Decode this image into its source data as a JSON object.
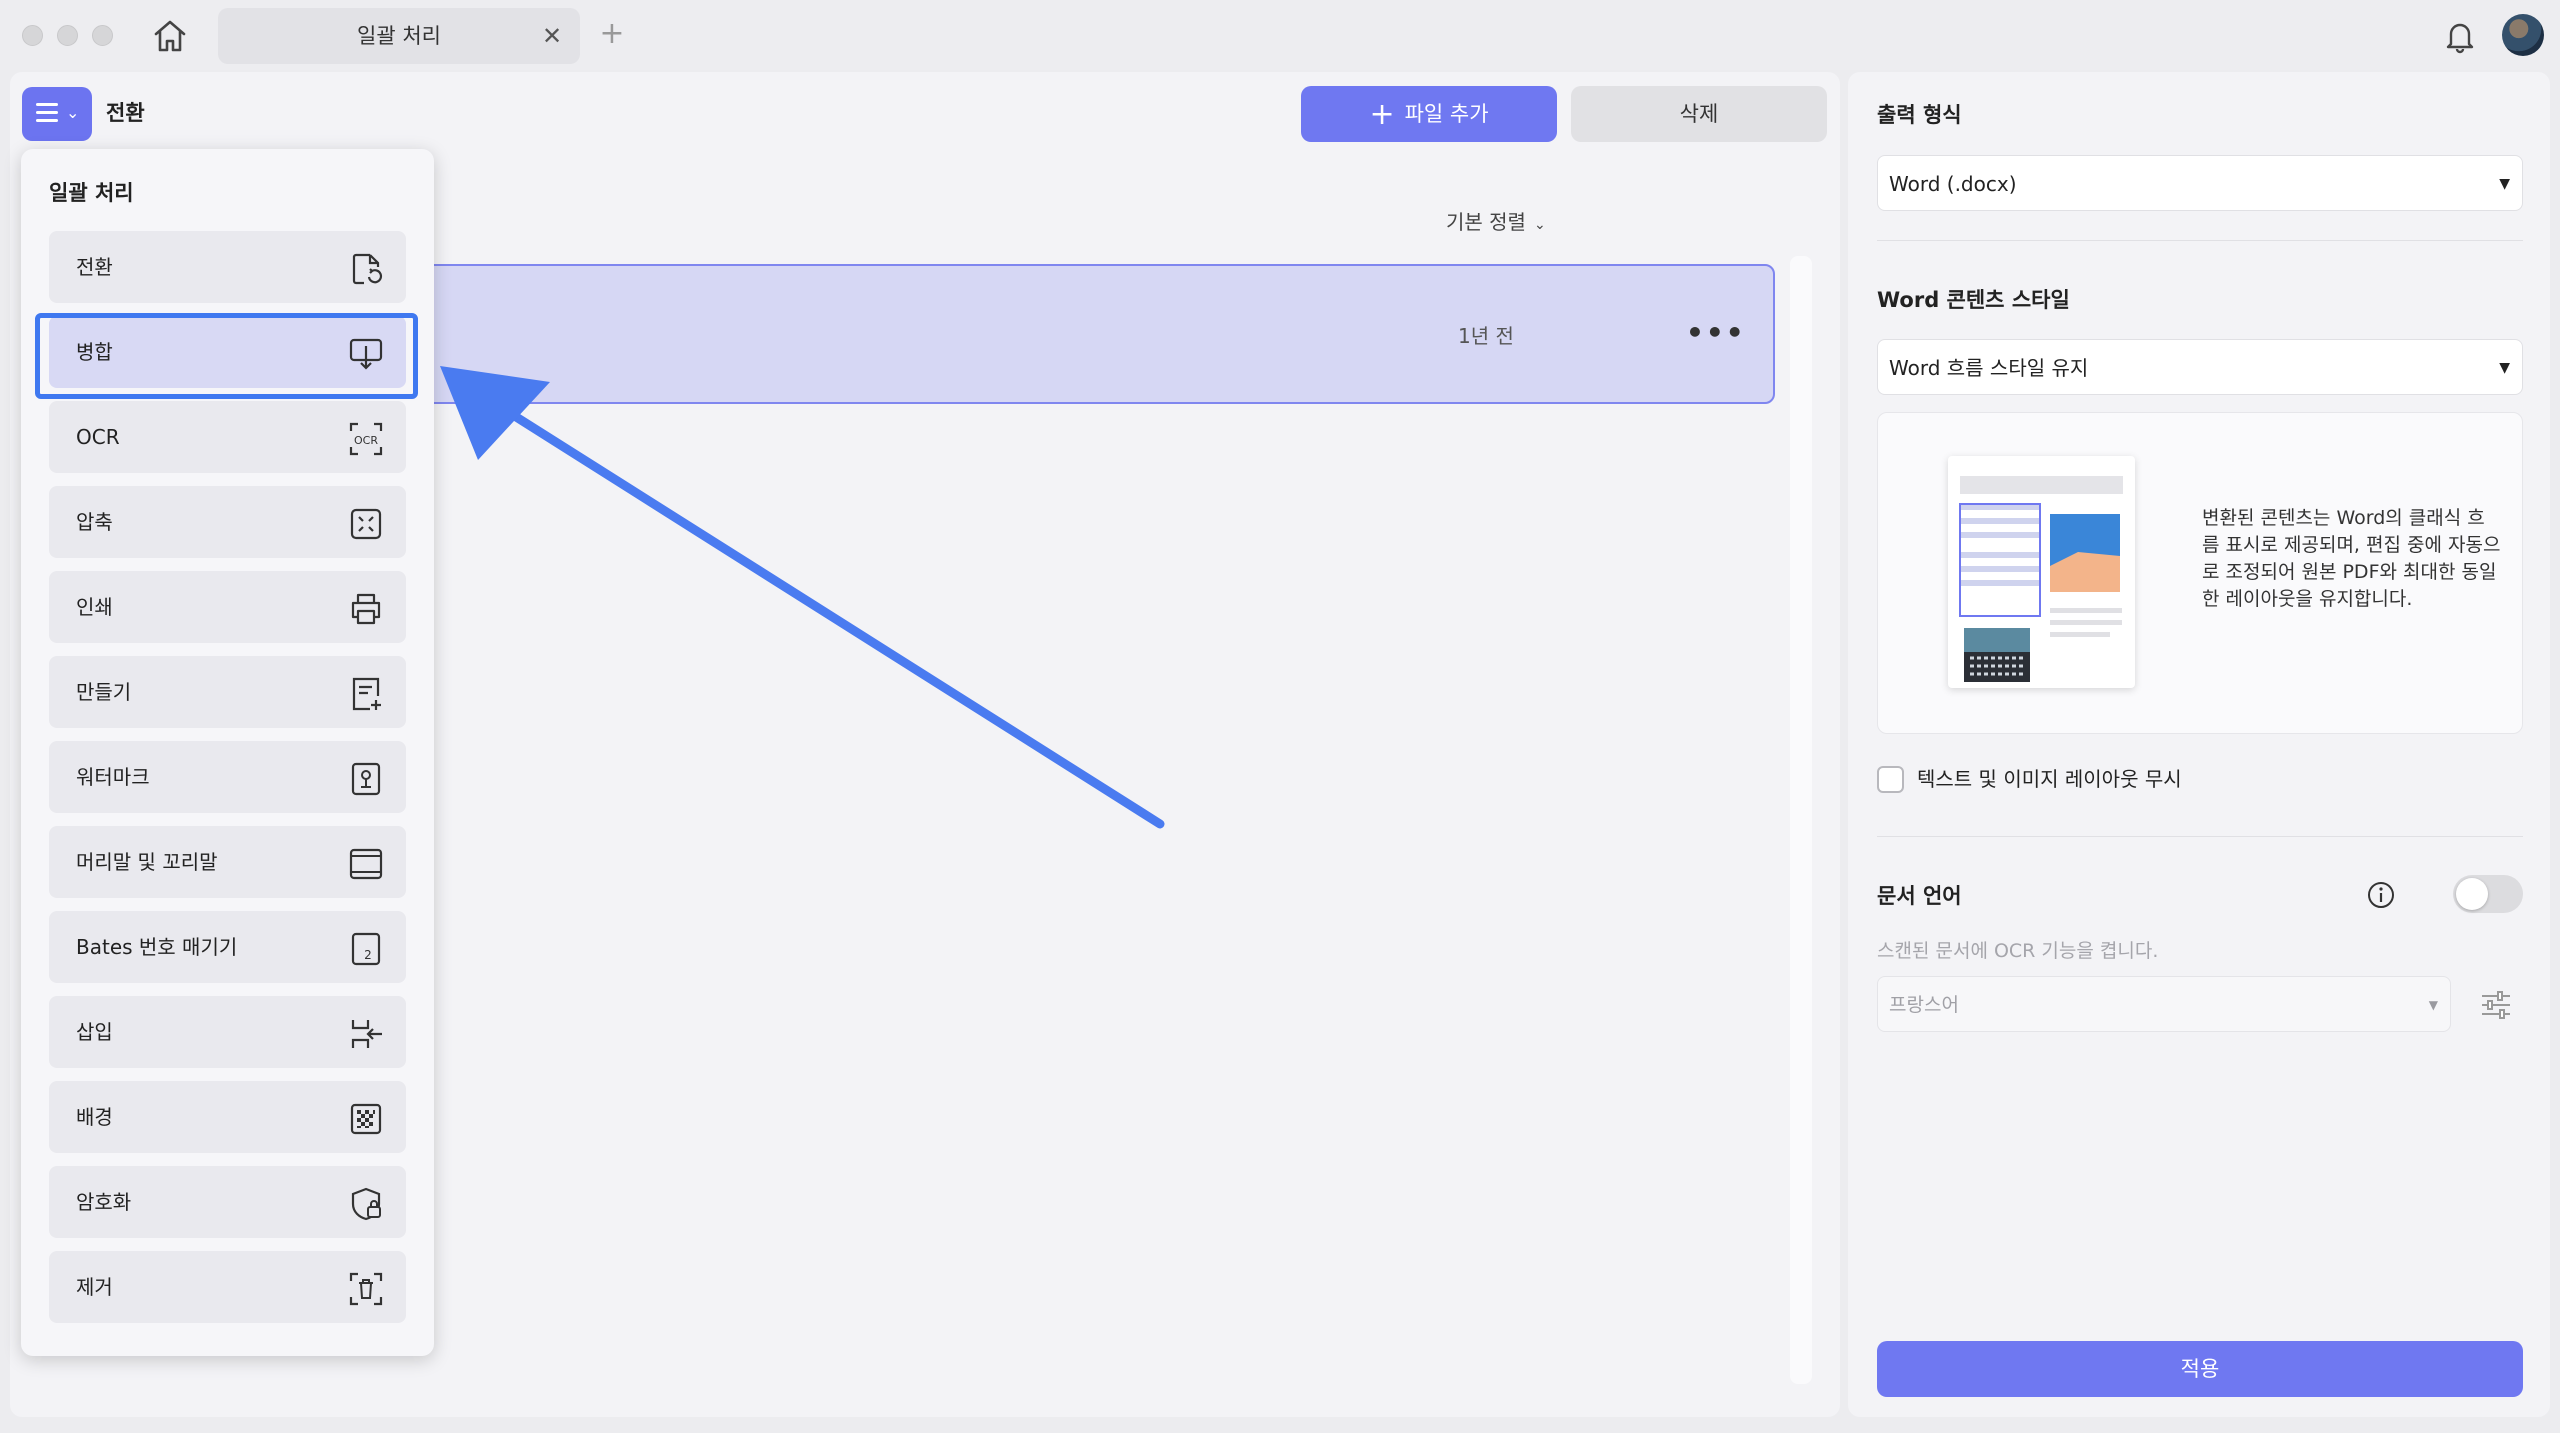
{
  "window": {
    "tab_title": "일괄 처리",
    "tab_close": "✕",
    "tab_add": "+"
  },
  "toolbar": {
    "mode_label": "전환",
    "add_file_label": "파일 추가",
    "add_file_icon": "+",
    "delete_label": "삭제",
    "sort_label": "기본 정렬"
  },
  "file_list": {
    "rows": [
      {
        "time": "1년 전",
        "more": "•••"
      }
    ]
  },
  "menu": {
    "title": "일괄 처리",
    "items": [
      {
        "label": "전환",
        "icon": "convert-icon"
      },
      {
        "label": "병합",
        "icon": "merge-icon",
        "selected": true
      },
      {
        "label": "OCR",
        "icon": "ocr-icon"
      },
      {
        "label": "압축",
        "icon": "compress-icon"
      },
      {
        "label": "인쇄",
        "icon": "print-icon"
      },
      {
        "label": "만들기",
        "icon": "create-icon"
      },
      {
        "label": "워터마크",
        "icon": "watermark-icon"
      },
      {
        "label": "머리말 및 꼬리말",
        "icon": "header-footer-icon"
      },
      {
        "label": "Bates 번호 매기기",
        "icon": "bates-icon"
      },
      {
        "label": "삽입",
        "icon": "insert-icon"
      },
      {
        "label": "배경",
        "icon": "background-icon"
      },
      {
        "label": "암호화",
        "icon": "encrypt-icon"
      },
      {
        "label": "제거",
        "icon": "remove-icon"
      }
    ]
  },
  "settings": {
    "output_format_heading": "출력 형식",
    "output_format_value": "Word (.docx)",
    "word_style_heading": "Word 콘텐츠 스타일",
    "word_style_value": "Word 흐름 스타일 유지",
    "style_description": "변환된 콘텐츠는 Word의 클래식 흐름 표시로 제공되며, 편집 중에 자동으로 조정되어 원본 PDF와 최대한 동일한 레이아웃을 유지합니다.",
    "ignore_layout_label": "텍스트 및 이미지 레이아웃 무시",
    "ignore_layout_checked": false,
    "doc_language_heading": "문서 언어",
    "doc_language_enabled": false,
    "ocr_hint": "스캔된 문서에 OCR 기능을 켭니다.",
    "language_value": "프랑스어",
    "apply_label": "적용"
  },
  "colors": {
    "accent": "#6f78f1",
    "highlight_outline": "#3f78f0",
    "arrow": "#4a7bf0",
    "selected_row": "#d6d7f4"
  }
}
